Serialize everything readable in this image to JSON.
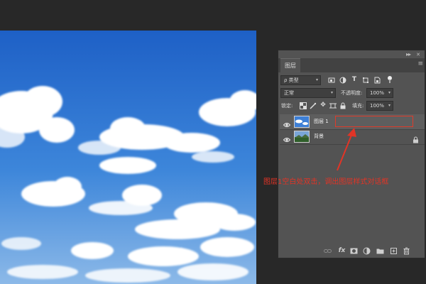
{
  "panel": {
    "tab_label": "图层",
    "filter_label": "ρ 类型",
    "blend_mode": "正常",
    "opacity_label": "不透明度:",
    "opacity_value": "100%",
    "lock_label": "锁定:",
    "fill_label": "填充:",
    "fill_value": "100%"
  },
  "layers": [
    {
      "name": "图层 1"
    },
    {
      "name": "背景"
    }
  ],
  "annotation": {
    "text": "图层1空白处双击，调出图层样式对话框",
    "color": "#e23426"
  },
  "colors": {
    "sky_top": "#1f63c9",
    "sky_bottom": "#8fb8e6",
    "panel_bg": "#535353",
    "app_bg": "#282828"
  }
}
